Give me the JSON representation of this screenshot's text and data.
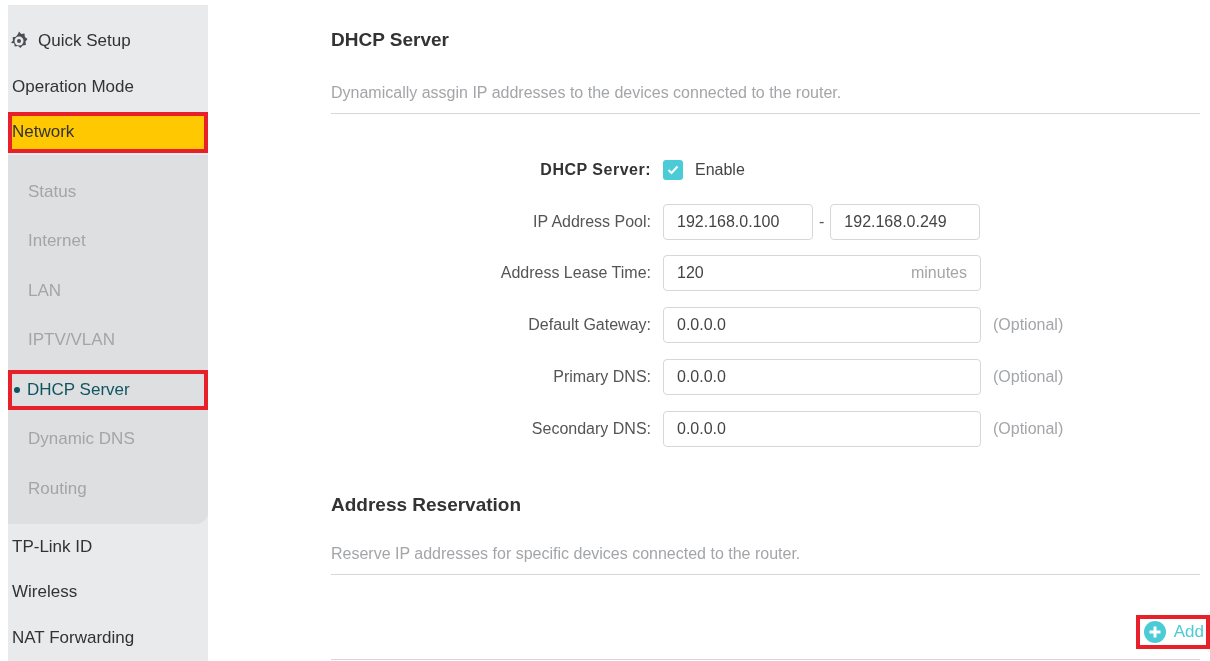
{
  "sidebar": {
    "items": [
      {
        "label": "Quick Setup",
        "kind": "setup",
        "selected": false,
        "highlighted": false
      },
      {
        "label": "Operation Mode",
        "kind": "plain",
        "selected": false,
        "highlighted": false
      },
      {
        "label": "Network",
        "kind": "plain",
        "selected": true,
        "highlighted": true,
        "children": [
          {
            "label": "Status",
            "selected": false,
            "highlighted": false
          },
          {
            "label": "Internet",
            "selected": false,
            "highlighted": false
          },
          {
            "label": "LAN",
            "selected": false,
            "highlighted": false
          },
          {
            "label": "IPTV/VLAN",
            "selected": false,
            "highlighted": false
          },
          {
            "label": "DHCP Server",
            "selected": true,
            "highlighted": true
          },
          {
            "label": "Dynamic DNS",
            "selected": false,
            "highlighted": false
          },
          {
            "label": "Routing",
            "selected": false,
            "highlighted": false
          }
        ]
      },
      {
        "label": "TP-Link ID",
        "kind": "plain",
        "selected": false,
        "highlighted": false
      },
      {
        "label": "Wireless",
        "kind": "plain",
        "selected": false,
        "highlighted": false
      },
      {
        "label": "NAT Forwarding",
        "kind": "plain",
        "selected": false,
        "highlighted": false
      }
    ]
  },
  "dhcp_server": {
    "title": "DHCP Server",
    "description": "Dynamically assgin IP addresses to the devices connected to the router.",
    "fields": [
      {
        "kind": "checkbox",
        "label": "DHCP Server:",
        "option": "Enable",
        "checked": true
      },
      {
        "kind": "range",
        "label": "IP Address Pool:",
        "from": "192.168.0.100",
        "separator": "-",
        "to": "192.168.0.249"
      },
      {
        "kind": "unit",
        "label": "Address Lease Time:",
        "value": "120",
        "unit": "minutes"
      },
      {
        "kind": "text",
        "label": "Default Gateway:",
        "value": "0.0.0.0",
        "note": "(Optional)"
      },
      {
        "kind": "text",
        "label": "Primary DNS:",
        "value": "0.0.0.0",
        "note": "(Optional)"
      },
      {
        "kind": "text",
        "label": "Secondary DNS:",
        "value": "0.0.0.0",
        "note": "(Optional)"
      }
    ]
  },
  "address_reservation": {
    "title": "Address Reservation",
    "description": "Reserve IP addresses for specific devices connected to the router.",
    "add_button": {
      "label": "Add",
      "highlighted": true
    }
  }
}
